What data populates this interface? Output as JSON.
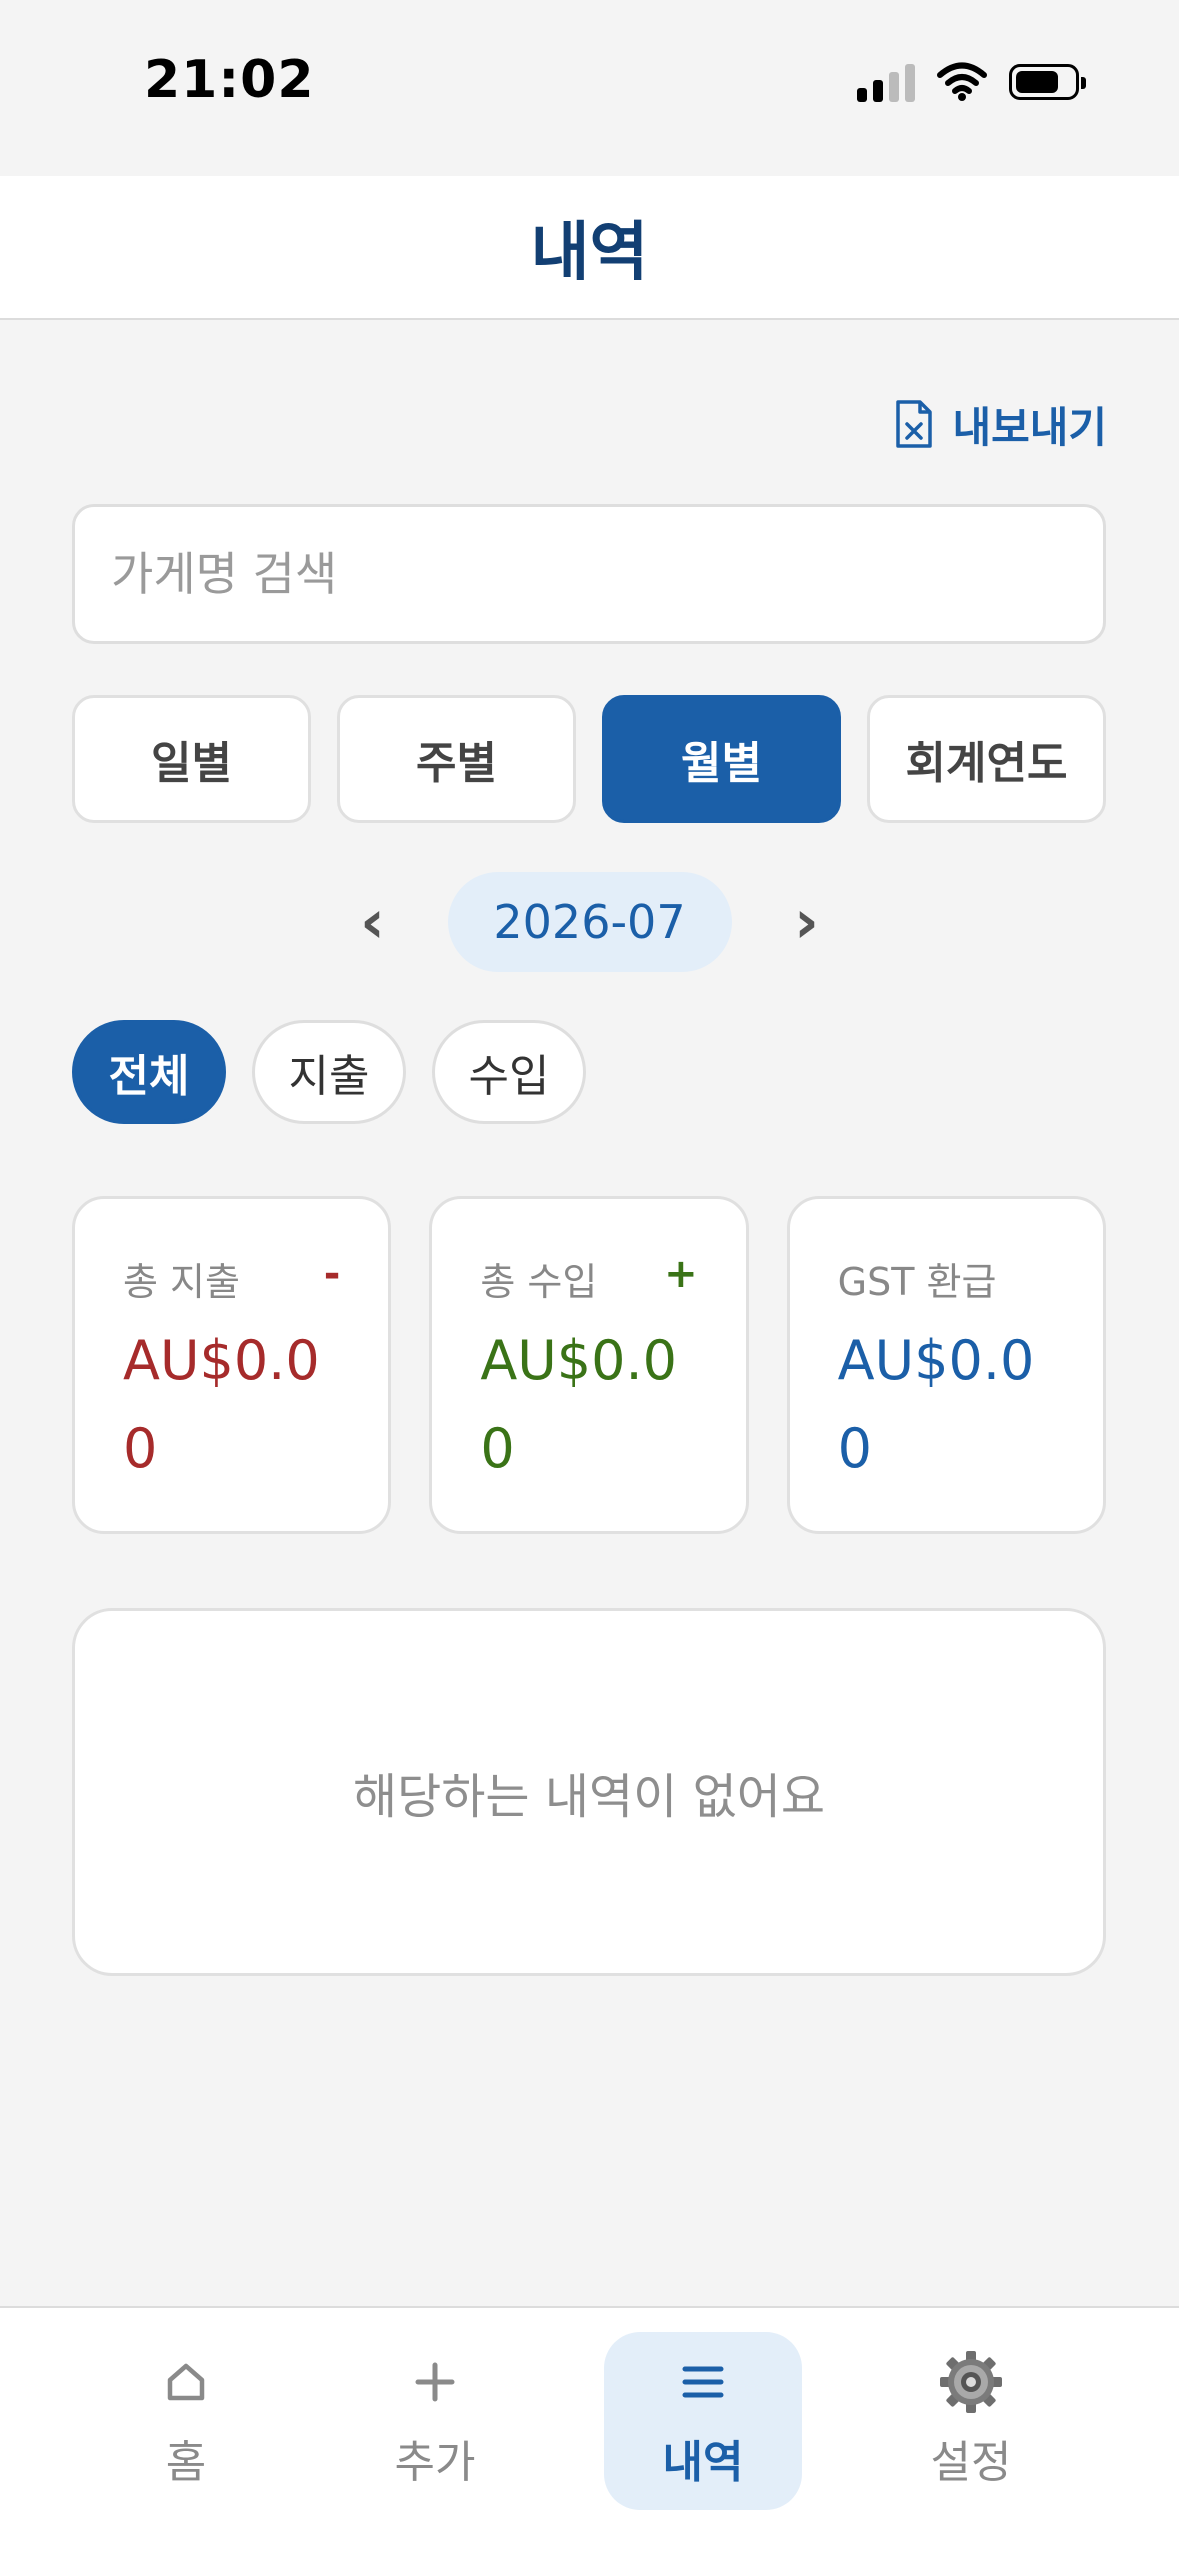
{
  "status_bar": {
    "time": "21:02"
  },
  "header": {
    "title": "내역"
  },
  "export": {
    "label": "내보내기"
  },
  "search": {
    "placeholder": "가게명 검색"
  },
  "period_tabs": [
    {
      "label": "일별",
      "active": false
    },
    {
      "label": "주별",
      "active": false
    },
    {
      "label": "월별",
      "active": true
    },
    {
      "label": "회계연도",
      "active": false
    }
  ],
  "month_nav": {
    "prev": "‹",
    "current": "2026-07",
    "next": "›"
  },
  "type_filters": [
    {
      "label": "전체",
      "active": true
    },
    {
      "label": "지출",
      "active": false
    },
    {
      "label": "수입",
      "active": false
    }
  ],
  "summary": {
    "expense": {
      "label": "총 지출",
      "sign": "-",
      "amount": "AU$0.00",
      "color": "#a62b2b"
    },
    "income": {
      "label": "총 수입",
      "sign": "+",
      "amount": "AU$0.00",
      "color": "#3a7317"
    },
    "gst": {
      "label": "GST 환급",
      "amount": "AU$0.00",
      "color": "#1b5fa8"
    }
  },
  "empty_state": {
    "message": "해당하는 내역이 없어요"
  },
  "bottom_nav": [
    {
      "label": "홈",
      "icon": "home-icon",
      "active": false
    },
    {
      "label": "추가",
      "icon": "plus-icon",
      "active": false
    },
    {
      "label": "내역",
      "icon": "list-icon",
      "active": true
    },
    {
      "label": "설정",
      "icon": "gear-icon",
      "active": false
    }
  ],
  "colors": {
    "accent": "#1b5fa8",
    "title": "#123f73",
    "accent_light": "#e3eef9"
  }
}
